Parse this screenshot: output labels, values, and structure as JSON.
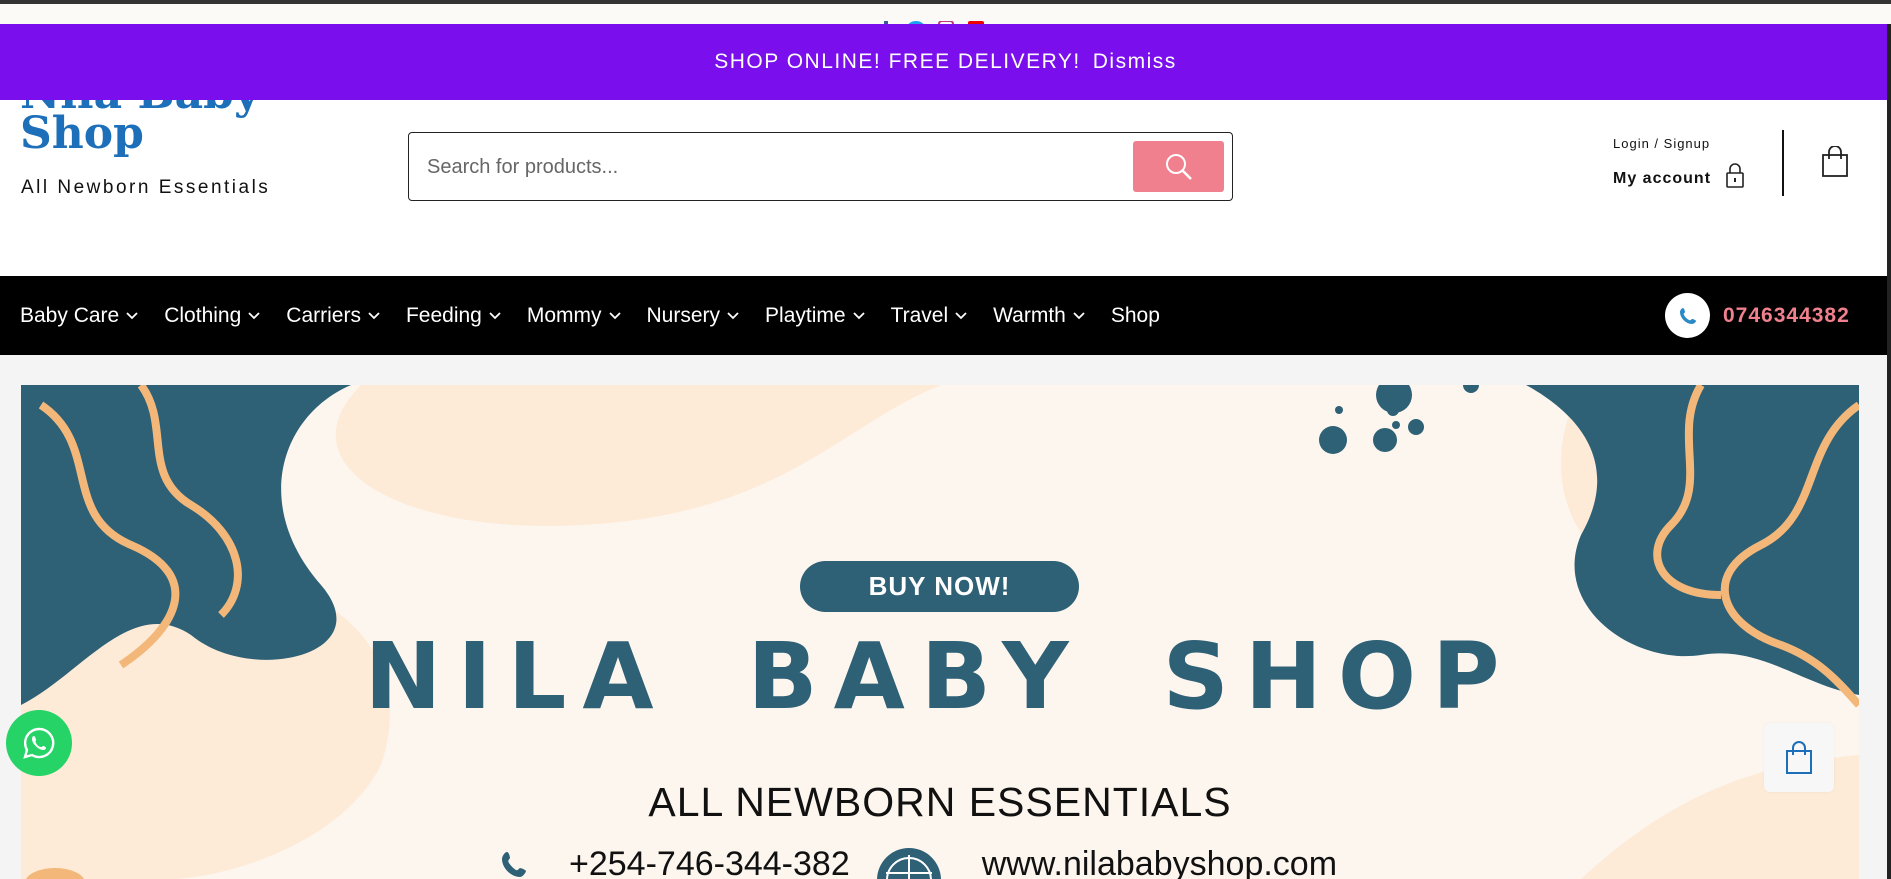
{
  "banner": {
    "message": "SHOP ONLINE! FREE DELIVERY!",
    "dismiss_label": "Dismiss",
    "color": "#7a0eec"
  },
  "social": [
    "facebook-icon",
    "twitter-icon",
    "instagram-icon",
    "youtube-icon"
  ],
  "logo": {
    "title": "Nila Baby Shop",
    "tagline": "All Newborn Essentials",
    "color": "#1c6fb8"
  },
  "search": {
    "placeholder": "Search for products...",
    "button_icon": "search-icon",
    "button_color": "#f0808d"
  },
  "account": {
    "login_label": "Login / Signup",
    "my_account_label": "My account",
    "lock_icon": "lock-icon",
    "cart_icon": "shopping-bag-icon"
  },
  "nav": {
    "items": [
      {
        "label": "Baby Care",
        "dropdown": true
      },
      {
        "label": "Clothing",
        "dropdown": true
      },
      {
        "label": "Carriers",
        "dropdown": true
      },
      {
        "label": "Feeding",
        "dropdown": true
      },
      {
        "label": "Mommy",
        "dropdown": true
      },
      {
        "label": "Nursery",
        "dropdown": true
      },
      {
        "label": "Playtime",
        "dropdown": true
      },
      {
        "label": "Travel",
        "dropdown": true
      },
      {
        "label": "Warmth",
        "dropdown": true
      },
      {
        "label": "Shop",
        "dropdown": false
      }
    ],
    "phone": "0746344382",
    "phone_icon": "phone-icon"
  },
  "hero": {
    "button": "BUY NOW!",
    "brand": "NILA BABY SHOP",
    "subtitle": "ALL NEWBORN ESSENTIALS",
    "phone": "+254-746-344-382",
    "website": "www.nilababyshop.com",
    "accent_color": "#2e6076",
    "stripe_color": "#f3b879"
  },
  "floating": {
    "whatsapp_icon": "whatsapp-icon",
    "cart_icon": "shopping-bag-icon"
  }
}
